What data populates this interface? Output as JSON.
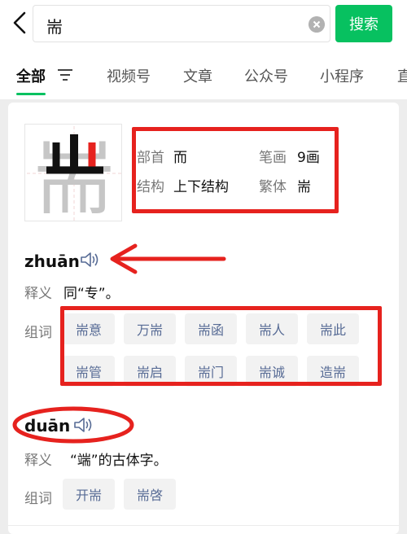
{
  "search": {
    "query": "耑",
    "button_label": "搜索"
  },
  "tabs": [
    "全部",
    "视频号",
    "文章",
    "公众号",
    "小程序",
    "直"
  ],
  "char": {
    "glyph": "耑"
  },
  "info": {
    "radical_label": "部首",
    "radical": "而",
    "strokes_label": "笔画",
    "strokes": "9画",
    "structure_label": "结构",
    "structure": "上下结构",
    "traditional_label": "繁体",
    "traditional": "耑"
  },
  "readings": [
    {
      "pinyin": "zhuān",
      "def_label": "释义",
      "definition": "同“专”。",
      "words_label": "组词",
      "words": [
        "耑意",
        "万耑",
        "耑函",
        "耑人",
        "耑此",
        "耑管",
        "耑启",
        "耑门",
        "耑诚",
        "造耑"
      ]
    },
    {
      "pinyin": "duān",
      "def_label": "释义",
      "definition": "“端”的古体字。",
      "words_label": "组词",
      "words": [
        "开耑",
        "耑啓"
      ]
    }
  ],
  "colors": {
    "accent": "#07c160",
    "annotation": "#e6221e",
    "link": "#576b95"
  }
}
